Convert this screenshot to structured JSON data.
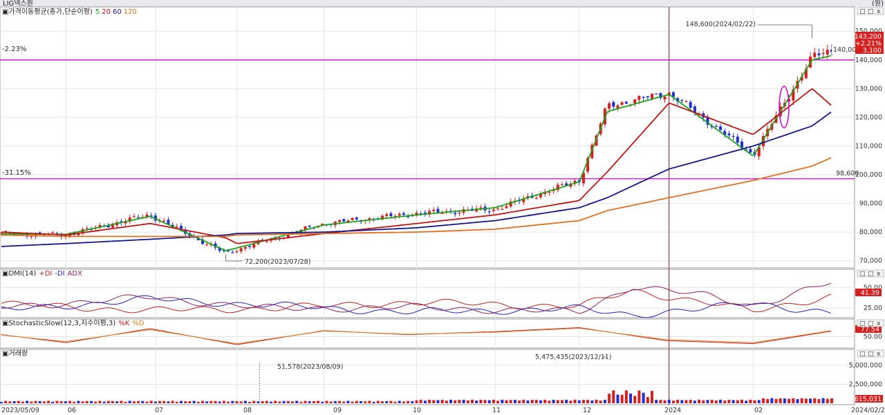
{
  "window": {
    "unit_label": "(원)"
  },
  "stock_name": "LIG넥스원",
  "colors": {
    "up": "#d62020",
    "down": "#1f2fd6",
    "ma5": "#1aa31a",
    "ma20": "#c01414",
    "ma60": "#14148c",
    "ma120": "#e07020",
    "hline": "#cc00cc",
    "vline": "#8b1a1a",
    "plus_di": "#c02020",
    "minus_di": "#2020c0",
    "adx": "#8b2060",
    "stoch_k": "#c02020",
    "stoch_d": "#e08020",
    "badge": "#d62020"
  },
  "panels": {
    "price": {
      "title": "가격이동평균(종가,단순이평)",
      "ma_labels": [
        "5",
        "20",
        "60",
        "120"
      ],
      "hline_labels": [
        "-2.23%",
        "-31.15%"
      ],
      "hline_prices": [
        140000,
        98600
      ],
      "hline_axis_labels": [
        "140,000",
        "98,600"
      ],
      "current_badge": [
        "143,200",
        "+2.21%",
        "3,100"
      ],
      "high_annotation": "148,600(2024/02/22)",
      "low_annotation": "72,200(2023/07/28)"
    },
    "dmi": {
      "title": "DMI(14)",
      "legend": [
        "+DI",
        "-DI",
        "ADX"
      ],
      "current": "41.39"
    },
    "stoch": {
      "title": "StochasticSlow(12,3,지수이평,3)",
      "legend": [
        "%K",
        "%D"
      ],
      "current": "77.54"
    },
    "volume": {
      "title": "거래량",
      "max_annotation": "5,475,435(2023/12/11)",
      "min_annotation": "51,578(2023/08/09)",
      "current": "615,031"
    }
  },
  "controls": [
    "□",
    "□",
    "x"
  ],
  "x_axis": [
    "2023/05/09",
    "06",
    "07",
    "08",
    "09",
    "10",
    "11",
    "12",
    "2024",
    "02",
    "2024/02/29"
  ],
  "chart_data": [
    {
      "type": "candlestick",
      "title": "LIG넥스원 가격이동평균(종가,단순이평)",
      "ylim": [
        68000,
        158000
      ],
      "y_ticks": [
        "150,000",
        "140,000",
        "130,000",
        "120,000",
        "110,000",
        "100,000",
        "90,000",
        "80,000",
        "70,000"
      ],
      "y_tick_values": [
        150000,
        140000,
        130000,
        120000,
        110000,
        100000,
        90000,
        80000,
        70000
      ],
      "x": [
        "2023-05-09",
        "2023-06-01",
        "2023-07-01",
        "2023-07-28",
        "2023-08-01",
        "2023-09-01",
        "2023-10-04",
        "2023-11-01",
        "2023-12-01",
        "2023-12-11",
        "2024-01-02",
        "2024-02-01",
        "2024-02-22",
        "2024-02-29"
      ],
      "close": [
        79500,
        79000,
        86000,
        72500,
        74000,
        83000,
        86500,
        88000,
        98000,
        124000,
        128500,
        107000,
        141000,
        143200
      ],
      "high_point": {
        "date": "2024-02-22",
        "value": 148600
      },
      "low_point": {
        "date": "2023-07-28",
        "value": 72200
      },
      "series": [
        {
          "name": "5",
          "values": [
            79400,
            79200,
            85500,
            73500,
            74500,
            82500,
            86000,
            88500,
            97500,
            122000,
            128000,
            106500,
            140000,
            141500
          ]
        },
        {
          "name": "20",
          "values": [
            80000,
            79000,
            83000,
            78000,
            76000,
            79500,
            83000,
            86000,
            91000,
            101000,
            125000,
            114000,
            130000,
            124000
          ]
        },
        {
          "name": "60",
          "values": [
            75000,
            76000,
            77500,
            79000,
            79500,
            80000,
            81500,
            84000,
            88500,
            92000,
            102000,
            110000,
            117000,
            122000
          ]
        },
        {
          "name": "120",
          "values": [
            79000,
            78500,
            78500,
            78500,
            79000,
            79500,
            80000,
            81000,
            84000,
            87500,
            92000,
            98000,
            103000,
            106000
          ]
        }
      ]
    },
    {
      "type": "line",
      "title": "DMI(14)",
      "ylim": [
        15,
        62
      ],
      "y_ticks": [
        "50.00",
        "25.00"
      ],
      "y_tick_values": [
        50,
        25
      ],
      "x": [
        "2023-05-09",
        "2023-07-01",
        "2023-08-15",
        "2023-10-01",
        "2023-12-01",
        "2023-12-20",
        "2024-01-15",
        "2024-02-01",
        "2024-02-29"
      ],
      "series": [
        {
          "name": "+DI",
          "values": [
            30,
            22,
            25,
            32,
            27,
            46,
            32,
            21,
            40
          ]
        },
        {
          "name": "-DI",
          "values": [
            22,
            36,
            28,
            20,
            24,
            17,
            24,
            32,
            18
          ]
        },
        {
          "name": "ADX",
          "values": [
            26,
            38,
            24,
            26,
            20,
            52,
            40,
            28,
            56
          ]
        }
      ],
      "current": 41.39
    },
    {
      "type": "line",
      "title": "StochasticSlow(12,3,지수이평,3)",
      "ylim": [
        0,
        100
      ],
      "y_ticks": [
        "50.00"
      ],
      "y_tick_values": [
        50
      ],
      "x": [
        "2023-05-09",
        "2023-06-01",
        "2023-07-01",
        "2023-08-01",
        "2023-09-01",
        "2023-10-01",
        "2023-11-01",
        "2023-12-01",
        "2024-01-01",
        "2024-02-01",
        "2024-02-29"
      ],
      "series": [
        {
          "name": "%K",
          "values": [
            60,
            20,
            90,
            10,
            80,
            60,
            75,
            95,
            30,
            15,
            77.54
          ]
        },
        {
          "name": "%D",
          "values": [
            58,
            25,
            85,
            15,
            78,
            62,
            72,
            92,
            35,
            20,
            80
          ]
        }
      ],
      "current": 77.54
    },
    {
      "type": "bar",
      "title": "거래량",
      "ylim": [
        0,
        6000000
      ],
      "y_ticks": [
        "5,000,000",
        "2,500,000"
      ],
      "y_tick_values": [
        5000000,
        2500000
      ],
      "highlights": [
        {
          "date": "2023-12-11",
          "value": 5475435
        },
        {
          "date": "2023-08-09",
          "value": 51578
        }
      ],
      "current": 615031
    }
  ]
}
